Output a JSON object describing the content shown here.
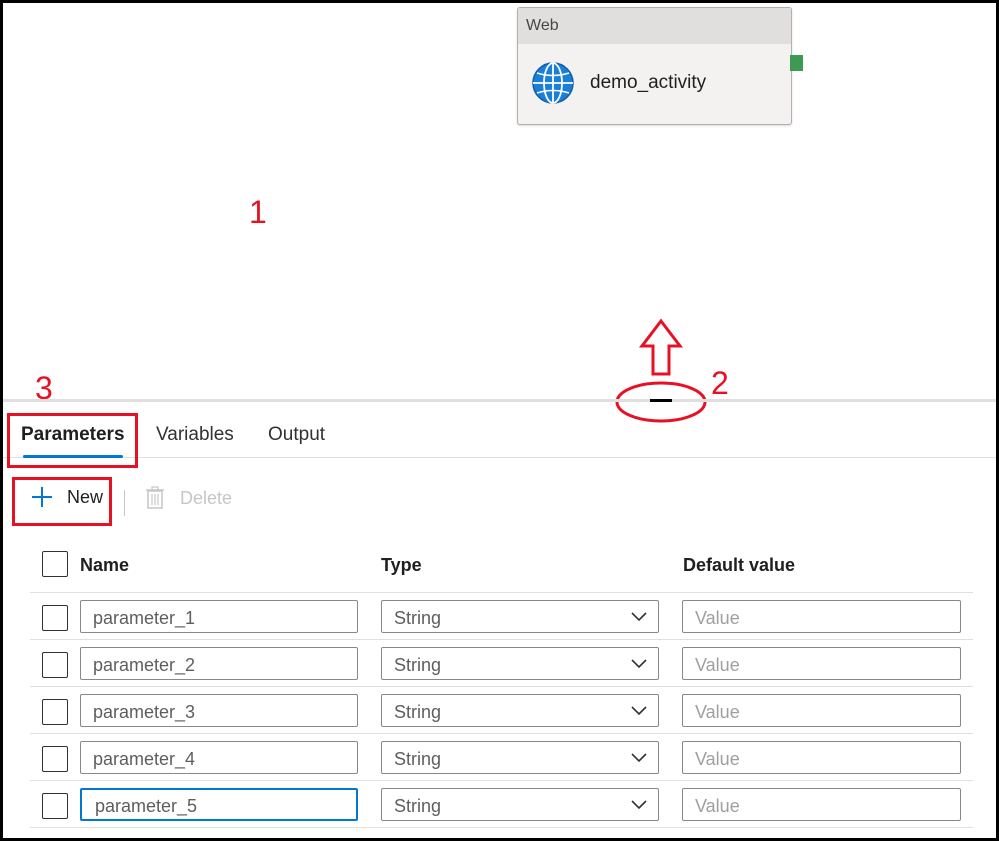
{
  "activity": {
    "category": "Web",
    "name": "demo_activity",
    "icon": "globe-icon"
  },
  "annotations": {
    "one": "1",
    "two": "2",
    "three": "3"
  },
  "tabs": [
    {
      "label": "Parameters",
      "active": true
    },
    {
      "label": "Variables",
      "active": false
    },
    {
      "label": "Output",
      "active": false
    }
  ],
  "toolbar": {
    "new_label": "New",
    "new_icon": "plus-icon",
    "delete_label": "Delete",
    "delete_icon": "trash-icon"
  },
  "table": {
    "columns": {
      "name": "Name",
      "type": "Type",
      "default": "Default value"
    },
    "rows": [
      {
        "name": "parameter_1",
        "type": "String",
        "placeholder": "Value"
      },
      {
        "name": "parameter_2",
        "type": "String",
        "placeholder": "Value"
      },
      {
        "name": "parameter_3",
        "type": "String",
        "placeholder": "Value"
      },
      {
        "name": "parameter_4",
        "type": "String",
        "placeholder": "Value"
      },
      {
        "name": "parameter_5",
        "type": "String",
        "placeholder": "Value"
      }
    ]
  },
  "colors": {
    "accent": "#0078d4",
    "annotation": "#e81123",
    "port": "#3c9a52"
  }
}
